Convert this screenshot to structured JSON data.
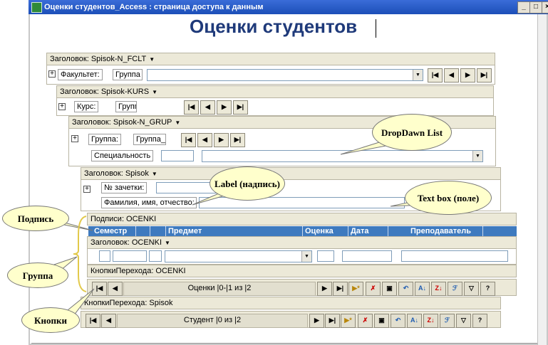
{
  "window": {
    "title": "Оценки студентов_Access : страница доступа к данным",
    "btn_min": "_",
    "btn_max": "□",
    "btn_close": "×"
  },
  "page_title": "Оценки студентов",
  "sections": {
    "fclt": {
      "header": "Заголовок: Spisok-N_FCLT",
      "label": "Факультет:",
      "label2": "Группа"
    },
    "kurs": {
      "header": "Заголовок: Spisok-KURS",
      "label": "Курс:",
      "label2": "Групп"
    },
    "grup": {
      "header": "Заголовок: Spisok-N_GRUP",
      "label": "Группа:",
      "label2": "Группа_",
      "label3": "Специальность"
    },
    "spisok": {
      "header": "Заголовок: Spisok",
      "label": "№ зачетки:",
      "label2": "Фамилия, имя, отчество:"
    },
    "captions": {
      "header": "Подписи: OCENKI",
      "columns": [
        "Семестр",
        "Предмет",
        "Оценка",
        "Дата",
        "Преподаватель"
      ]
    },
    "ocenki": {
      "header": "Заголовок: OCENKI"
    },
    "nav_ocenki": {
      "header": "КнопкиПерехода: OCENKI",
      "text": "Оценки |0-|1 из |2"
    },
    "nav_spisok": {
      "header": "КнопкиПерехода: Spisok",
      "text": "Студент |0 из |2"
    }
  },
  "nav_glyphs": {
    "first": "|◀",
    "prev": "◀",
    "next": "▶",
    "last": "▶|",
    "new": "▶*",
    "delete": "✗",
    "save": "▣",
    "undo": "↶",
    "sort_asc": "A↓",
    "sort_desc": "Z↓",
    "filter_sel": "ℱ",
    "filter": "▽",
    "help": "?"
  },
  "callouts": {
    "dropdown": "DropDawn List",
    "label": "Label (надпись)",
    "textbox": "Text box (поле)",
    "caption": "Подпись",
    "group": "Группа",
    "buttons": "Кнопки"
  },
  "colors": {
    "title_bar": "#1c4fb8",
    "header_bg": "#ece9d8",
    "column_header": "#3e7abf",
    "callout_bg": "#ffffcc",
    "page_title": "#1f3a7a"
  }
}
